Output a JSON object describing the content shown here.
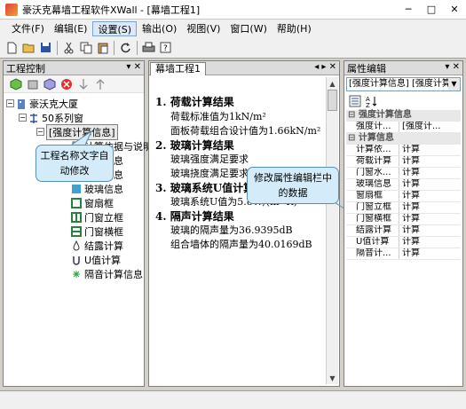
{
  "window": {
    "title": "豪沃克幕墙工程软件XWall  - [幕墙工程1]",
    "minimize": "─",
    "maximize": "□",
    "close": "✕"
  },
  "menu": [
    {
      "label": "文件(F)",
      "active": false
    },
    {
      "label": "编辑(E)",
      "active": false
    },
    {
      "label": "设置(S)",
      "active": true
    },
    {
      "label": "输出(O)",
      "active": false
    },
    {
      "label": "视图(V)",
      "active": false
    },
    {
      "label": "窗口(W)",
      "active": false
    },
    {
      "label": "帮助(H)",
      "active": false
    }
  ],
  "left": {
    "title": "工程控制",
    "pin": "▾ ✕",
    "tree": {
      "root": "豪沃克大厦",
      "series": "50系列窗",
      "selected": "[强度计算信息]",
      "items": [
        "计算依据与说明",
        "窗框信息",
        "窗扇信息",
        "玻璃信息",
        "窗扇框",
        "门窗立框",
        "门窗横框",
        "结露计算",
        "U值计算",
        "隔音计算信息"
      ]
    }
  },
  "center": {
    "tab": "幕墙工程1",
    "nav": "◂ ▸ ✕",
    "lines": [
      {
        "t": "1.  荷载计算结果",
        "k": "h"
      },
      {
        "t": "荷载标准值为1kN/m²",
        "k": "b"
      },
      {
        "t": "面板荷载组合设计值为1.66kN/m²",
        "k": "b"
      },
      {
        "t": "2.  玻璃计算结果",
        "k": "h"
      },
      {
        "t": "玻璃强度满足要求",
        "k": "b"
      },
      {
        "t": "玻璃挠度满足要求",
        "k": "b"
      },
      {
        "t": "3.  玻璃系统U值计算结果",
        "k": "h"
      },
      {
        "t": "玻璃系统U值为5.8W/(m²·K)",
        "k": "b"
      },
      {
        "t": "4.  隔声计算结果",
        "k": "h"
      },
      {
        "t": "玻璃的隔声量为36.9395dB",
        "k": "b"
      },
      {
        "t": "组合墙体的隔声量为40.0169dB",
        "k": "b"
      }
    ]
  },
  "right": {
    "title": "属性编辑",
    "pin": "▾ ✕",
    "combo": "[强度计算信息] [强度计算",
    "cat1": "强度计算信息",
    "row1": {
      "k": "强度计...",
      "v": "[强度计..."
    },
    "cat2": "计算信息",
    "rows": [
      {
        "k": "计算依...",
        "v": "计算"
      },
      {
        "k": "荷载计算",
        "v": "计算"
      },
      {
        "k": "门窗水...",
        "v": "计算"
      },
      {
        "k": "玻璃信息",
        "v": "计算"
      },
      {
        "k": "窗扇框",
        "v": "计算"
      },
      {
        "k": "门窗立框",
        "v": "计算"
      },
      {
        "k": "门窗横框",
        "v": "计算"
      },
      {
        "k": "结露计算",
        "v": "计算"
      },
      {
        "k": "U值计算",
        "v": "计算"
      },
      {
        "k": "隔音计...",
        "v": "计算"
      }
    ]
  },
  "callouts": {
    "left": "工程名称文字自动修改",
    "right": "修改属性编辑栏中的数据"
  }
}
